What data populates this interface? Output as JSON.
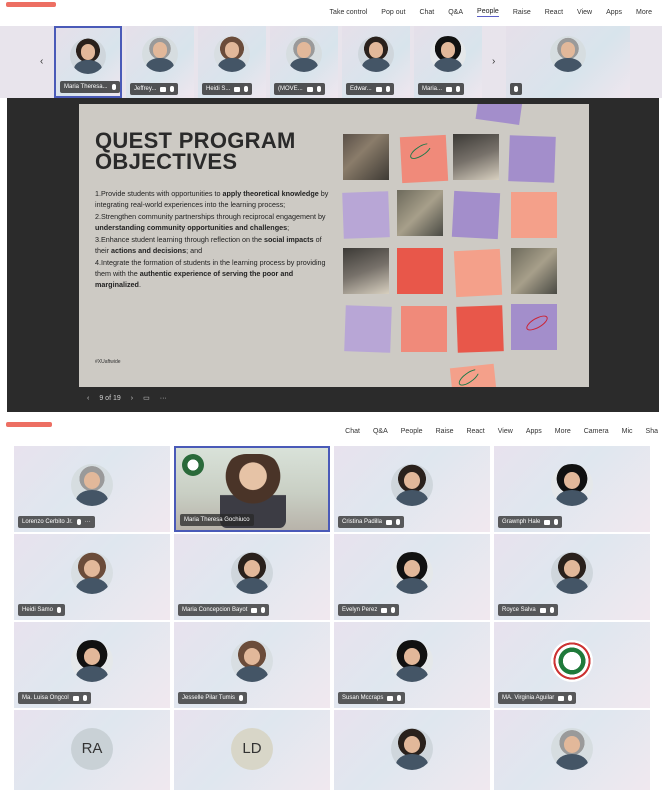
{
  "screen1": {
    "toolbar": [
      "Take control",
      "Pop out",
      "Chat",
      "Q&A",
      "People",
      "Raise",
      "React",
      "View",
      "Apps",
      "More"
    ],
    "toolbar_active": "People",
    "filmstrip": [
      {
        "name": "Maria Theresa...",
        "mic": true,
        "cam": false,
        "active": true
      },
      {
        "name": "Jeffrey...",
        "mic": true,
        "cam": true
      },
      {
        "name": "Heidi S...",
        "mic": true,
        "cam": true
      },
      {
        "name": "(MOVE...",
        "mic": true,
        "cam": true
      },
      {
        "name": "Edwar...",
        "mic": true,
        "cam": true
      },
      {
        "name": "Maria...",
        "mic": true,
        "cam": true
      },
      {
        "name": "",
        "mic": true,
        "cam": false
      }
    ],
    "slide": {
      "title_line1": "QUEST PROGRAM",
      "title_line2": "OBJECTIVES",
      "objectives": [
        {
          "pre": "1.Provide students with opportunities to ",
          "bold": "apply theoretical knowledge",
          "post": " by integrating real-world experiences into the learning process;"
        },
        {
          "pre": "2.Strengthen community partnerships through reciprocal engagement by ",
          "bold": "understanding community opportunities and challenges",
          "post": ";"
        },
        {
          "pre": "3.Enhance student learning through reflection on the ",
          "bold": "social impacts",
          "post": " of their ",
          "bold2": "actions and decisions",
          "post2": "; and"
        },
        {
          "pre": "4.Integrate the formation of students in the learning process by providing them with the ",
          "bold": "authentic experience of serving the poor and marginalized",
          "post": "."
        }
      ],
      "tag": "#XUaftwide"
    },
    "slide_nav": {
      "counter": "9 of 19"
    }
  },
  "screen2": {
    "toolbar": [
      "Chat",
      "Q&A",
      "People",
      "Raise",
      "React",
      "View",
      "Apps",
      "More",
      "Camera",
      "Mic",
      "Sha"
    ],
    "participants": [
      {
        "name": "Lorenzo Cerbito Jr.",
        "icons": "mic-more",
        "kind": "grey"
      },
      {
        "name": "Maria Theresa Gochiuco",
        "icons": "",
        "kind": "video",
        "active": true
      },
      {
        "name": "Cristina Padilla",
        "icons": "cam-mic",
        "kind": "dark"
      },
      {
        "name": "Grawnph Hale",
        "icons": "cam-mic",
        "kind": "black"
      },
      {
        "name": "Heidi Samo",
        "icons": "mic",
        "kind": "light"
      },
      {
        "name": "Maria Concepcion Bayot",
        "icons": "cam-mic",
        "kind": "dark"
      },
      {
        "name": "Evelyn Perez",
        "icons": "cam-mic",
        "kind": "black"
      },
      {
        "name": "Royce Salva",
        "icons": "cam-mic",
        "kind": "dark"
      },
      {
        "name": "Ma. Luisa Ongcol",
        "icons": "cam-mic",
        "kind": "black"
      },
      {
        "name": "Jesselle Pilar Tumis",
        "icons": "mic",
        "kind": "light"
      },
      {
        "name": "Susan Mccraps",
        "icons": "cam-mic",
        "kind": "black"
      },
      {
        "name": "MA. Virginia Aguilar",
        "icons": "cam-mic",
        "kind": "seal"
      },
      {
        "name": "",
        "icons": "",
        "kind": "initials",
        "initials": "RA"
      },
      {
        "name": "",
        "icons": "",
        "kind": "initials",
        "initials": "LD"
      },
      {
        "name": "",
        "icons": "",
        "kind": "dark"
      },
      {
        "name": "",
        "icons": "",
        "kind": "grey"
      }
    ]
  }
}
